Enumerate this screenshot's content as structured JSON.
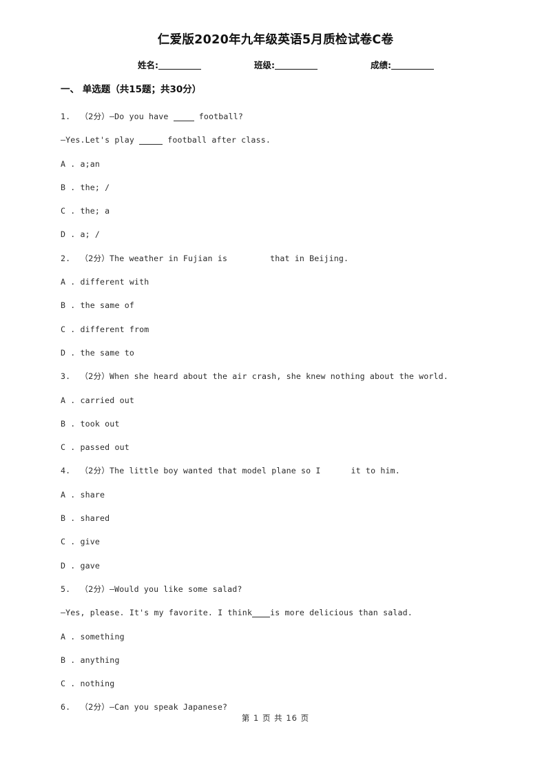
{
  "document": {
    "title": "仁爱版2020年九年级英语5月质检试卷C卷",
    "meta_fields": [
      {
        "label": "姓名:"
      },
      {
        "label": "班级:"
      },
      {
        "label": "成绩:"
      }
    ]
  },
  "section": {
    "heading": "一、  单选题（共15题；共30分）"
  },
  "questions": [
    {
      "number": "1.",
      "points": "（2分）",
      "stem_before": "—Do you have ",
      "stem_after": " football?",
      "blank": "underline",
      "continuation": "—Yes.Let's play _____ football after class.",
      "cont_before": "—Yes.Let's play ",
      "cont_after": " football after class.",
      "options": [
        {
          "label": "A .",
          "text": "a;an"
        },
        {
          "label": "B .",
          "text": "the; /"
        },
        {
          "label": "C .",
          "text": "the; a"
        },
        {
          "label": "D .",
          "text": "a; /"
        }
      ]
    },
    {
      "number": "2.",
      "points": "（2分）",
      "stem_before": "The weather in Fujian is",
      "stem_after": "that in Beijing.",
      "blank": "space",
      "options": [
        {
          "label": "A .",
          "text": "different with"
        },
        {
          "label": "B .",
          "text": "the same of"
        },
        {
          "label": "C .",
          "text": "different from"
        },
        {
          "label": "D .",
          "text": "the same to"
        }
      ]
    },
    {
      "number": "3.",
      "points": "（2分）",
      "stem_full": "When she heard about the air crash, she knew nothing about the world.",
      "options": [
        {
          "label": "A .",
          "text": "carried out"
        },
        {
          "label": "B .",
          "text": "took out"
        },
        {
          "label": "C .",
          "text": "passed out"
        }
      ]
    },
    {
      "number": "4.",
      "points": "（2分）",
      "stem_before": "The little boy wanted that model plane so I",
      "stem_after": "it to him.",
      "blank": "space",
      "options": [
        {
          "label": "A .",
          "text": "share"
        },
        {
          "label": "B .",
          "text": "shared"
        },
        {
          "label": "C .",
          "text": "give"
        },
        {
          "label": "D .",
          "text": "gave"
        }
      ]
    },
    {
      "number": "5.",
      "points": "（2分）",
      "stem_full": "—Would you like some salad?",
      "cont_before": "—Yes, please. It's my favorite. I think",
      "cont_after": "is more delicious than salad.",
      "options": [
        {
          "label": "A .",
          "text": "something"
        },
        {
          "label": "B .",
          "text": "anything"
        },
        {
          "label": "C .",
          "text": "nothing"
        }
      ]
    },
    {
      "number": "6.",
      "points": "（2分）",
      "stem_full": "—Can you speak Japanese?",
      "options": []
    }
  ],
  "footer": {
    "page_indicator": "第 1 页  共 16 页"
  }
}
